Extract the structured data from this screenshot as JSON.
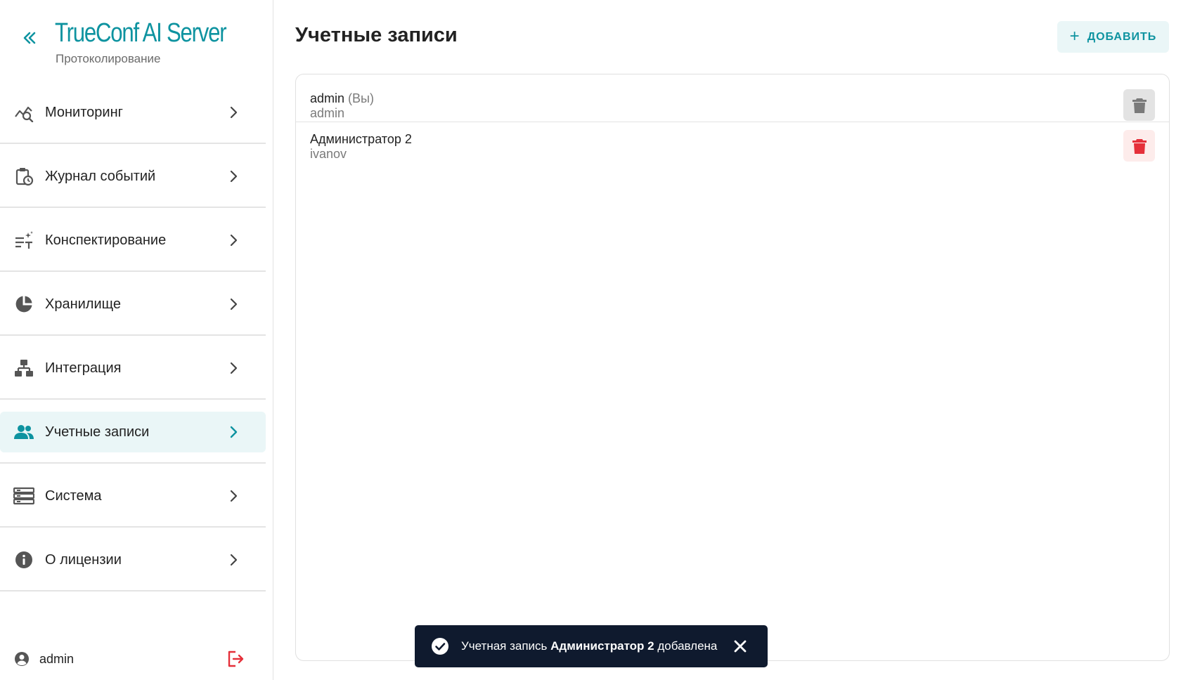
{
  "brand": {
    "title": "TrueConf AI Server",
    "subtitle": "Протоколирование"
  },
  "sidebar": {
    "items": [
      {
        "label": "Мониторинг",
        "icon": "monitoring-chart-icon"
      },
      {
        "label": "Журнал событий",
        "icon": "event-log-clipboard-icon"
      },
      {
        "label": "Конспектирование",
        "icon": "summary-text-icon"
      },
      {
        "label": "Хранилище",
        "icon": "storage-pie-icon"
      },
      {
        "label": "Интеграция",
        "icon": "integration-hierarchy-icon"
      },
      {
        "label": "Учетные записи",
        "icon": "users-icon",
        "active": true
      },
      {
        "label": "Система",
        "icon": "system-server-icon"
      },
      {
        "label": "О лицензии",
        "icon": "info-icon"
      }
    ],
    "user": {
      "name": "admin"
    }
  },
  "main": {
    "title": "Учетные записи",
    "add_label": "ДОБАВИТЬ",
    "accounts": [
      {
        "name": "admin",
        "you": "(Вы)",
        "login": "admin"
      },
      {
        "name": "Администратор 2",
        "login": "ivanov"
      }
    ]
  },
  "toast": {
    "prefix": "Учетная запись ",
    "bold": "Администратор 2",
    "suffix": " добавлена"
  },
  "colors": {
    "accent": "#0e93a0",
    "active_bg": "#eaf6f7",
    "danger": "#e5303a",
    "toast_bg": "#0f1a2e"
  }
}
